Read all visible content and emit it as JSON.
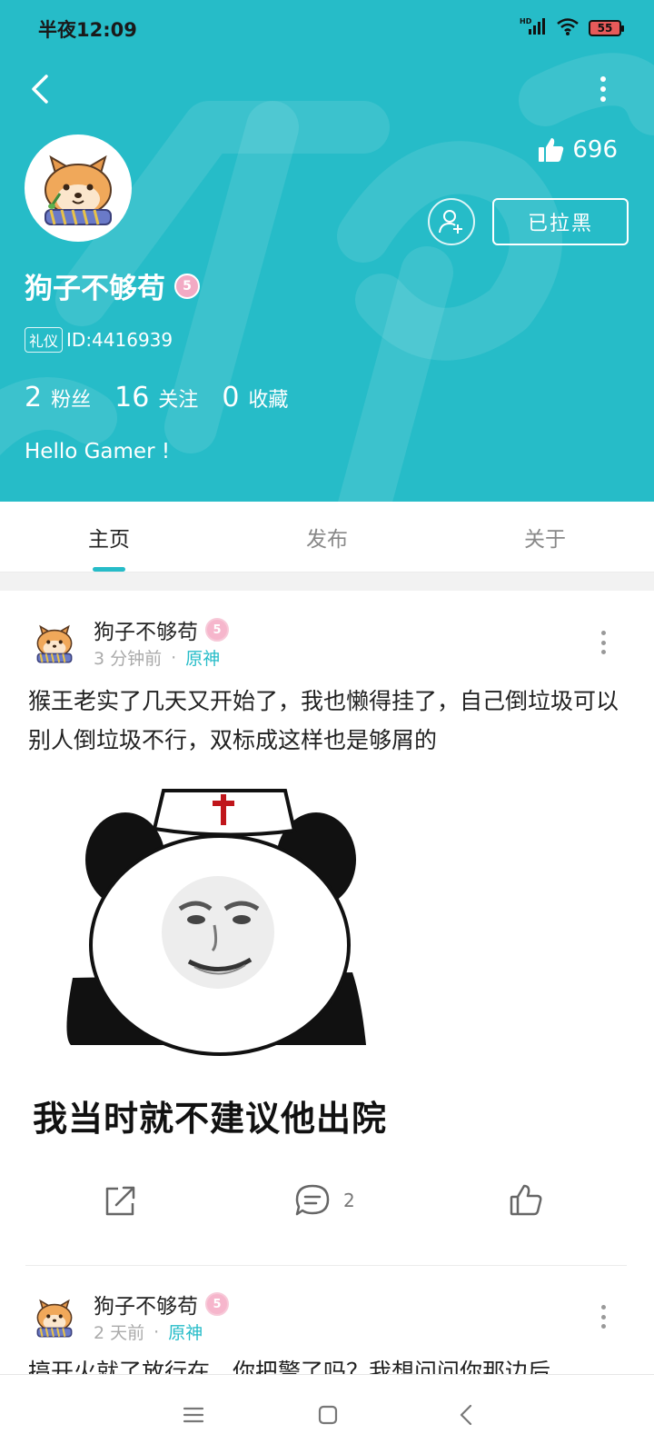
{
  "status_bar": {
    "time": "半夜12:09",
    "network": "HD",
    "battery": "55"
  },
  "profile": {
    "likes_count": "696",
    "blocked_label": "已拉黑",
    "username": "狗子不够苟",
    "level_badge": "5",
    "tag": "礼仪",
    "user_id": "ID:4416939",
    "stats": [
      {
        "num": "2",
        "label": "粉丝"
      },
      {
        "num": "16",
        "label": "关注"
      },
      {
        "num": "0",
        "label": "收藏"
      }
    ],
    "bio": "Hello Gamer !"
  },
  "tabs": [
    {
      "label": "主页",
      "active": true
    },
    {
      "label": "发布",
      "active": false
    },
    {
      "label": "关于",
      "active": false
    }
  ],
  "posts": [
    {
      "author": "狗子不够苟",
      "level_badge": "5",
      "time": "3 分钟前",
      "separator": "·",
      "game": "原神",
      "text": "猴王老实了几天又开始了，我也懒得挂了，自己倒垃圾可以别人倒垃圾不行，双标成这样也是够屑的",
      "image_caption": "我当时就不建议他出院",
      "comment_count": "2"
    },
    {
      "author": "狗子不够苟",
      "level_badge": "5",
      "time": "2 天前",
      "separator": "·",
      "game": "原神",
      "text": "搞开火就了放行在，你把警了吗？我想问问你那边后"
    }
  ],
  "colors": {
    "accent": "#26bcc8",
    "badge_pink": "#f2aac4"
  },
  "icons": [
    "back-icon",
    "more-icon",
    "thumbs-up-icon",
    "add-user-icon",
    "share-icon",
    "comment-icon",
    "like-icon",
    "menu-icon",
    "home-icon",
    "nav-back-icon"
  ]
}
